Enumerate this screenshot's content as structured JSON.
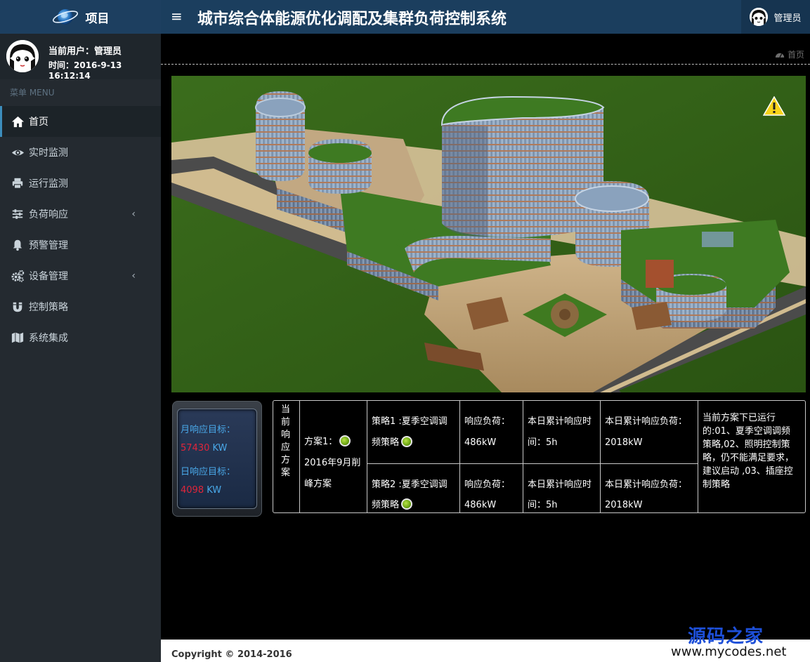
{
  "header": {
    "brand": "项目",
    "menu_toggle": "≡",
    "title": "城市综合体能源优化调配及集群负荷控制系统",
    "user_name": "管理员"
  },
  "user_panel": {
    "current_user": "当前用户：管理员",
    "time": "时间：2016-9-13 16:12:14"
  },
  "sidebar": {
    "menu_header": "菜单 MENU",
    "items": [
      {
        "label": "首页",
        "icon": "home-icon",
        "active": true
      },
      {
        "label": "实时监测",
        "icon": "eye-icon"
      },
      {
        "label": "运行监测",
        "icon": "print-icon"
      },
      {
        "label": "负荷响应",
        "icon": "sliders-icon",
        "expandable": true
      },
      {
        "label": "预警管理",
        "icon": "bell-icon"
      },
      {
        "label": "设备管理",
        "icon": "gears-icon",
        "expandable": true
      },
      {
        "label": "控制策略",
        "icon": "magnet-icon"
      },
      {
        "label": "系统集成",
        "icon": "map-icon"
      }
    ],
    "chevron": "‹"
  },
  "breadcrumb": {
    "label": "首页",
    "icon": "dashboard-icon"
  },
  "targets": {
    "monthly_label": "月响应目标：",
    "monthly_value": "57430",
    "daily_label": "日响应目标：",
    "daily_value": "4098",
    "unit": " KW"
  },
  "plan": {
    "section_label": [
      "当",
      "前",
      "响",
      "应",
      "方",
      "案"
    ],
    "plan_name": "方案1：",
    "plan_desc_1": "2016年9月削",
    "plan_desc_2": "峰方案",
    "rows": [
      {
        "strategy_1": "策略1 :夏季空调调",
        "strategy_2": "频策略",
        "load_label": "响应负荷：",
        "load_value": "486kW",
        "time_label_1": "本日累计响应时",
        "time_label_2": "间：5h",
        "total_label": "本日累计响应负荷：",
        "total_value": "2018kW"
      },
      {
        "strategy_1": "策略2 :夏季空调调",
        "strategy_2": "频策略",
        "load_label": "响应负荷：",
        "load_value": "486kW",
        "time_label_1": "本日累计响应时",
        "time_label_2": "间：5h",
        "total_label": "本日累计响应负荷：",
        "total_value": "2018kW"
      }
    ],
    "note_lines": [
      "当前方案下已运行",
      "的:01、夏季空调调频",
      "策略,02、照明控制策",
      "略，仍不能满足要求，",
      "建议启动 ,03、插座控",
      "制策略"
    ]
  },
  "footer": {
    "copyright": "Copyright © 2014-2016"
  },
  "watermark": {
    "cn": "源码之家",
    "en": "www.mycodes.net"
  },
  "colors": {
    "header_bg": "#1b3e5e",
    "sidebar_bg": "#242a30",
    "accent_blue": "#49a8e8",
    "value_red": "#e0253a",
    "status_green": "#6ca413"
  }
}
